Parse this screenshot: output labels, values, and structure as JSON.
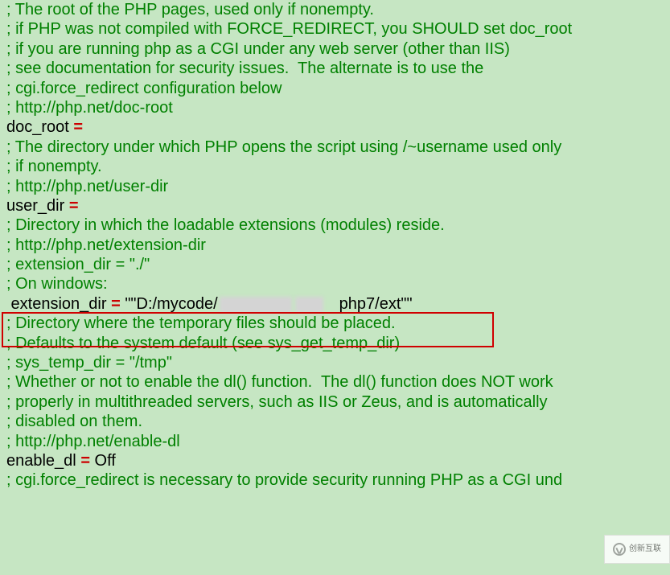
{
  "lines": {
    "l0": "; The root of the PHP pages, used only if nonempty.",
    "l1": "; if PHP was not compiled with FORCE_REDIRECT, you SHOULD set doc_root",
    "l2": "; if you are running php as a CGI under any web server (other than IIS)",
    "l3": "; see documentation for security issues.  The alternate is to use the",
    "l4": "; cgi.force_redirect configuration below",
    "l5": "; http://php.net/doc-root",
    "l6k": "doc_root ",
    "l6e": "=",
    "l7": "",
    "l8": "; The directory under which PHP opens the script using /~username used only",
    "l9": "; if nonempty.",
    "l10": "; http://php.net/user-dir",
    "l11k": "user_dir ",
    "l11e": "=",
    "l12": "",
    "l13": "; Directory in which the loadable extensions (modules) reside.",
    "l14": "; http://php.net/extension-dir",
    "l15": "; extension_dir = \"./\"",
    "l16": "; On windows:",
    "l17k": " extension_dir ",
    "l17e": "=",
    "l17v_a": " \"\"D:/mycode/",
    "l17v_b": "php7/ext\"\"",
    "l18": "",
    "l19": "; Directory where the temporary files should be placed.",
    "l20": "; Defaults to the system default (see sys_get_temp_dir)",
    "l21": "; sys_temp_dir = \"/tmp\"",
    "l22": "",
    "l23": "; Whether or not to enable the dl() function.  The dl() function does NOT work",
    "l24": "; properly in multithreaded servers, such as IIS or Zeus, and is automatically",
    "l25": "; disabled on them.",
    "l26": "; http://php.net/enable-dl",
    "l27k": "enable_dl ",
    "l27e": "=",
    "l27v": " Off",
    "l28": "",
    "l29": "; cgi.force_redirect is necessary to provide security running PHP as a CGI und"
  },
  "logo_text": "创新互联"
}
